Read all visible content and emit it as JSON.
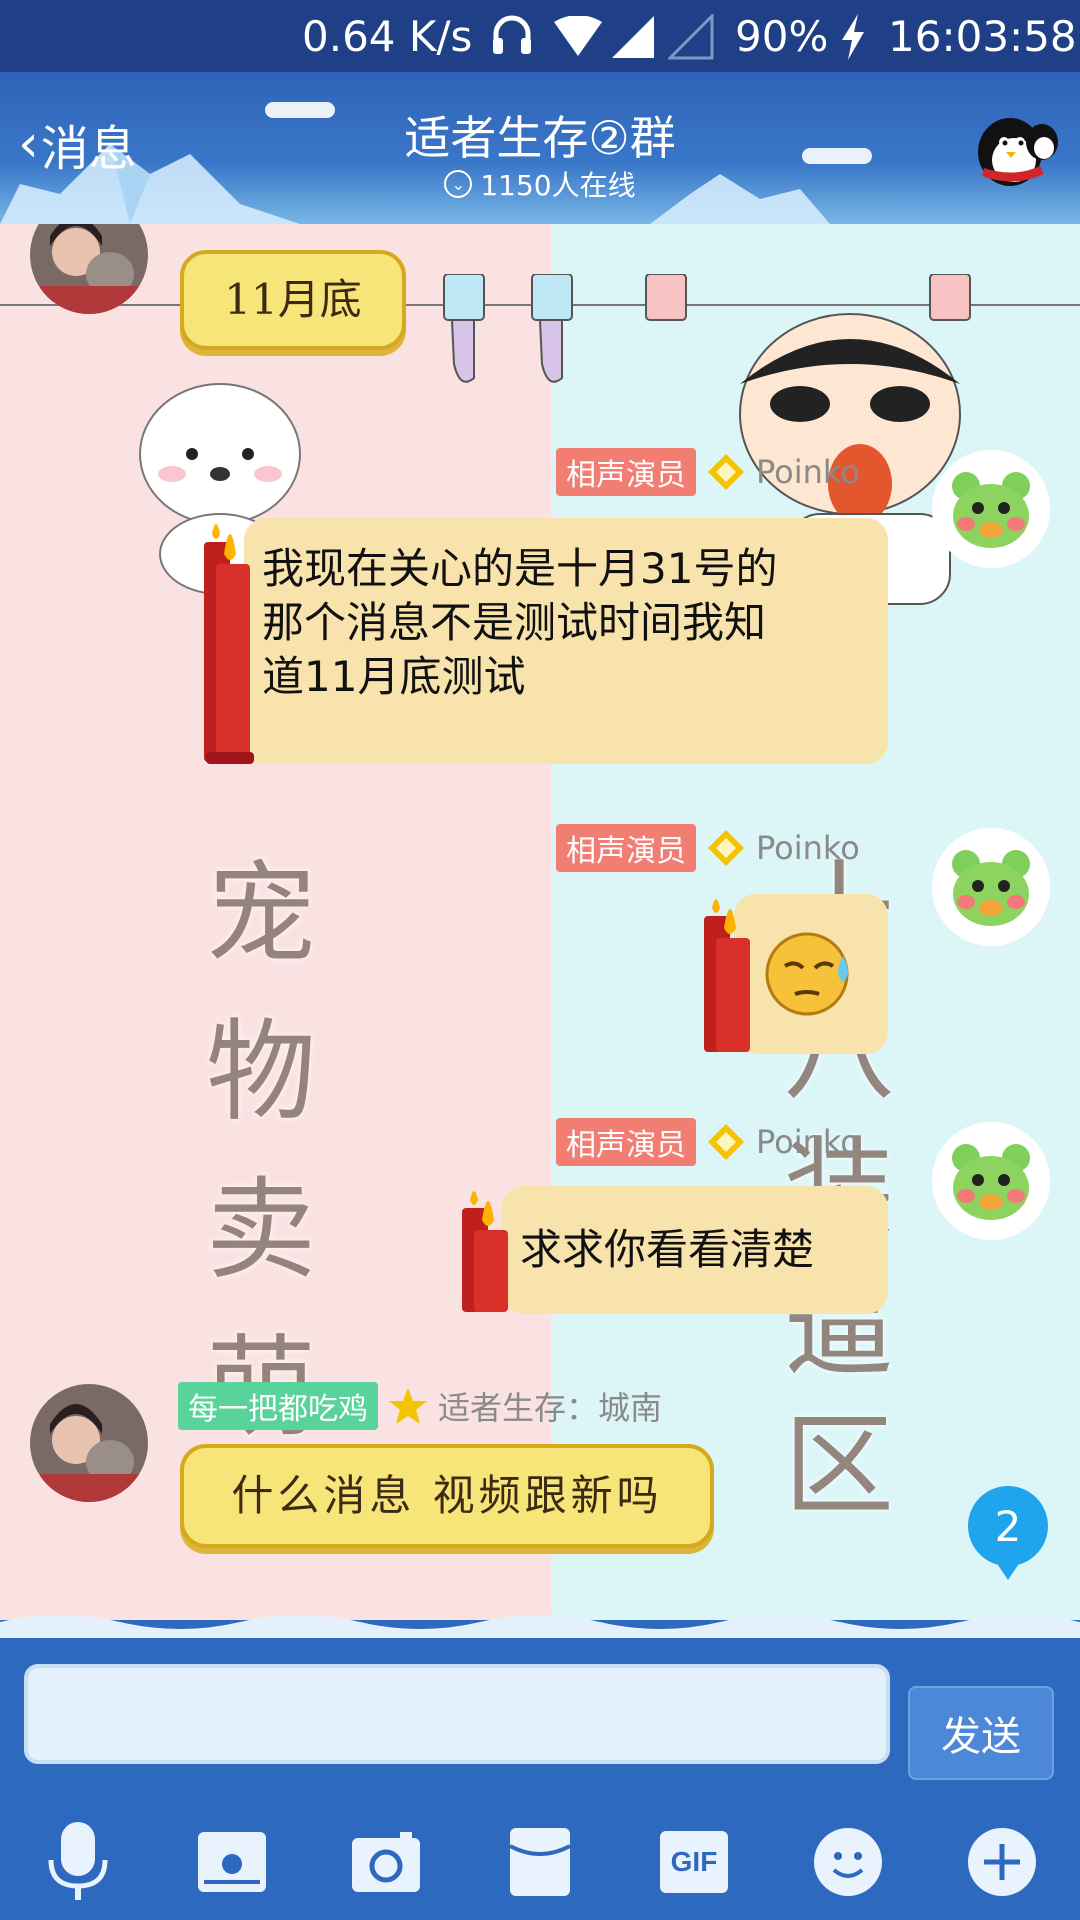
{
  "status_bar": {
    "speed": "0.64 K/s",
    "battery": "90%",
    "time": "16:03:58",
    "icons": [
      "headphones-icon",
      "wifi-icon",
      "signal-icon",
      "no-signal-icon",
      "charging-icon"
    ]
  },
  "header": {
    "back_label": "消息",
    "title": "适者生存②群",
    "online": "1150人在线"
  },
  "background": {
    "left_chars": [
      "宠",
      "物",
      "卖",
      "萌"
    ],
    "right_chars": [
      "十",
      "八",
      "装",
      "逼",
      "区"
    ]
  },
  "messages": [
    {
      "sender_tag": "每一把都吃鸡",
      "sender_name": "适者生存：城南",
      "text": "11月底",
      "side": "left"
    },
    {
      "sender_tag": "相声演员",
      "sender_name": "Poinko",
      "text": "我现在关心的是十月31号的那个消息不是测试时间我知道11月底测试",
      "lines": [
        "我现在关心的是十月31号的",
        "那个消息不是测试时间我知",
        "道11月底测试"
      ],
      "side": "right"
    },
    {
      "sender_tag": "相声演员",
      "sender_name": "Poinko",
      "text": "",
      "emoji": "sweating-face-emoji",
      "side": "right"
    },
    {
      "sender_tag": "相声演员",
      "sender_name": "Poinko",
      "text": "求求你看看清楚",
      "side": "right"
    },
    {
      "sender_tag": "每一把都吃鸡",
      "sender_name": "适者生存：城南",
      "text": "什么消息 视频跟新吗",
      "side": "left"
    }
  ],
  "unread_count": "2",
  "input": {
    "value": "",
    "send_label": "发送"
  },
  "toolbar": [
    "microphone-icon",
    "image-icon",
    "camera-icon",
    "red-packet-icon",
    "gif-icon",
    "emoji-icon",
    "plus-icon"
  ],
  "toolbar_gif_label": "GIF",
  "colors": {
    "header_blue": "#3a77c8",
    "tag_pink": "#f27d72",
    "tag_green": "#58d39a",
    "unread_blue": "#1ea5ee"
  }
}
